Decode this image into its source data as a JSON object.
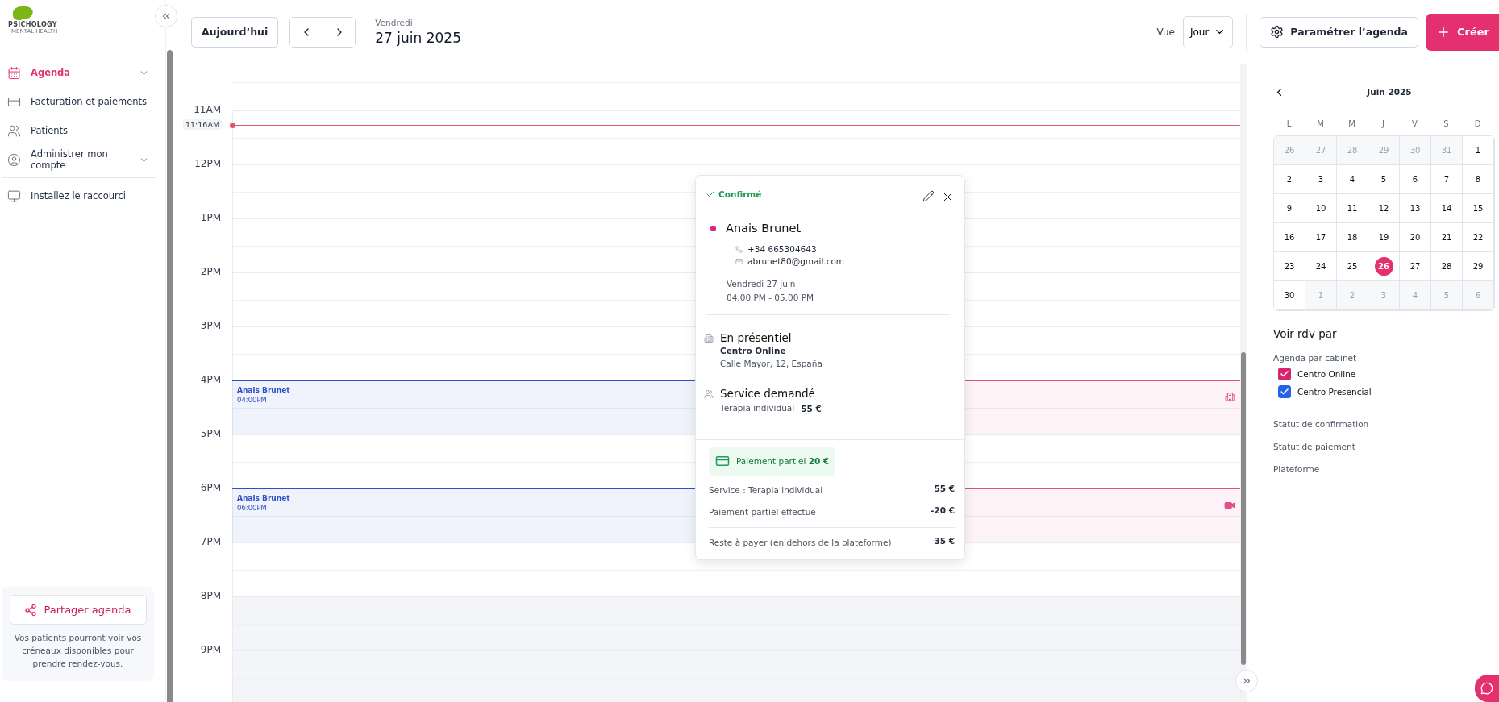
{
  "sidebar": {
    "logo": {
      "name": "PSICHOLOGY",
      "tagline": "MENTAL HEALTH"
    },
    "items": [
      {
        "label": "Agenda",
        "selected": true,
        "expandable": true
      },
      {
        "label": "Facturation et paiements",
        "selected": false,
        "expandable": false
      },
      {
        "label": "Patients",
        "selected": false,
        "expandable": false
      },
      {
        "label": "Administrer mon compte",
        "selected": false,
        "expandable": true
      }
    ],
    "shortcut": "Installez le raccourci",
    "share": {
      "button": "Partager agenda",
      "text": "Vos patients pourront voir vos créneaux disponibles pour prendre rendez-vous."
    }
  },
  "header": {
    "today": "Aujourd’hui",
    "weekday": "Vendredi",
    "date": "27 juin 2025",
    "view_label": "Vue",
    "view": "Jour",
    "settings": "Paramétrer l’agenda",
    "create": "Créer"
  },
  "calendar": {
    "hours": [
      {
        "label": "11AM",
        "available": true,
        "now": "11:16AM"
      },
      {
        "label": "12PM",
        "available": true
      },
      {
        "label": "1PM",
        "available": true
      },
      {
        "label": "2PM",
        "available": true
      },
      {
        "label": "3PM",
        "available": true
      },
      {
        "label": "4PM",
        "available": true,
        "events": [
          {
            "kind": "details",
            "name": "Anais Brunet",
            "time": "04:00PM",
            "color": "#2f4fc7"
          },
          {
            "kind": "in_person",
            "color": "#e0508a"
          }
        ]
      },
      {
        "label": "5PM",
        "available": true
      },
      {
        "label": "6PM",
        "available": true,
        "events": [
          {
            "kind": "details",
            "name": "Anais Brunet",
            "time": "06:00PM",
            "color": "#2f4fc7"
          },
          {
            "kind": "video",
            "color": "#e0508a"
          }
        ]
      },
      {
        "label": "7PM",
        "available": true
      },
      {
        "label": "8PM",
        "available": false
      },
      {
        "label": "9PM",
        "available": false
      }
    ]
  },
  "popup": {
    "status": "Confirmé",
    "patient": {
      "name": "Anais Brunet",
      "color": "#e0247a",
      "phone": "+34 665304643",
      "email": "abrunet80@gmail.com"
    },
    "date": "Vendredi 27 juin",
    "time": "04.00 PM - 05.00 PM",
    "location": {
      "mode": "En présentiel",
      "center": "Centro Online",
      "address": "Calle Mayor, 12, España"
    },
    "service": {
      "title": "Service demandé",
      "name": "Terapia individual",
      "price": "55 €"
    },
    "payment": {
      "badge": "Paiement partiel **20 €**",
      "lines": [
        {
          "label": "Service : Terapia individual",
          "amount": "55 €"
        },
        {
          "label": "Paiement partiel effectué",
          "amount": "-20 €"
        }
      ],
      "total": {
        "label": "Reste à payer (en dehors de la plateforme)",
        "amount": "35 €"
      }
    }
  },
  "mini_calendar": {
    "month": "Juin 2025",
    "weekdays": [
      "L",
      "M",
      "M",
      "J",
      "V",
      "S",
      "D"
    ],
    "weeks": [
      [
        {
          "day": "26",
          "outside": true,
          "selected": false
        },
        {
          "day": "27",
          "outside": true,
          "selected": false
        },
        {
          "day": "28",
          "outside": true,
          "selected": false
        },
        {
          "day": "29",
          "outside": true,
          "selected": false
        },
        {
          "day": "30",
          "outside": true,
          "selected": false
        },
        {
          "day": "31",
          "outside": true,
          "selected": false
        },
        {
          "day": "1",
          "outside": false,
          "selected": false
        }
      ],
      [
        {
          "day": "2",
          "outside": false,
          "selected": false
        },
        {
          "day": "3",
          "outside": false,
          "selected": false
        },
        {
          "day": "4",
          "outside": false,
          "selected": false
        },
        {
          "day": "5",
          "outside": false,
          "selected": false
        },
        {
          "day": "6",
          "outside": false,
          "selected": false
        },
        {
          "day": "7",
          "outside": false,
          "selected": false
        },
        {
          "day": "8",
          "outside": false,
          "selected": false
        }
      ],
      [
        {
          "day": "9",
          "outside": false,
          "selected": false
        },
        {
          "day": "10",
          "outside": false,
          "selected": false
        },
        {
          "day": "11",
          "outside": false,
          "selected": false
        },
        {
          "day": "12",
          "outside": false,
          "selected": false
        },
        {
          "day": "13",
          "outside": false,
          "selected": false
        },
        {
          "day": "14",
          "outside": false,
          "selected": false
        },
        {
          "day": "15",
          "outside": false,
          "selected": false
        }
      ],
      [
        {
          "day": "16",
          "outside": false,
          "selected": false
        },
        {
          "day": "17",
          "outside": false,
          "selected": false
        },
        {
          "day": "18",
          "outside": false,
          "selected": false
        },
        {
          "day": "19",
          "outside": false,
          "selected": false
        },
        {
          "day": "20",
          "outside": false,
          "selected": false
        },
        {
          "day": "21",
          "outside": false,
          "selected": false
        },
        {
          "day": "22",
          "outside": false,
          "selected": false
        }
      ],
      [
        {
          "day": "23",
          "outside": false,
          "selected": false
        },
        {
          "day": "24",
          "outside": false,
          "selected": false
        },
        {
          "day": "25",
          "outside": false,
          "selected": false
        },
        {
          "day": "26",
          "outside": false,
          "selected": true
        },
        {
          "day": "27",
          "outside": false,
          "selected": false
        },
        {
          "day": "28",
          "outside": false,
          "selected": false
        },
        {
          "day": "29",
          "outside": false,
          "selected": false
        }
      ],
      [
        {
          "day": "30",
          "outside": false,
          "selected": false
        },
        {
          "day": "1",
          "outside": true,
          "selected": false
        },
        {
          "day": "2",
          "outside": true,
          "selected": false
        },
        {
          "day": "3",
          "outside": true,
          "selected": false
        },
        {
          "day": "4",
          "outside": true,
          "selected": false
        },
        {
          "day": "5",
          "outside": true,
          "selected": false
        },
        {
          "day": "6",
          "outside": true,
          "selected": false
        }
      ]
    ]
  },
  "filters": {
    "title": "Voir rdv par",
    "group": "Agenda par cabinet",
    "centers": [
      {
        "label": "Centro Online",
        "checked": true,
        "color": "#d6246e"
      },
      {
        "label": "Centro Presencial",
        "checked": true,
        "color": "#2563eb"
      }
    ],
    "others": [
      "Statut de confirmation",
      "Statut de paiement",
      "Plateforme"
    ]
  }
}
